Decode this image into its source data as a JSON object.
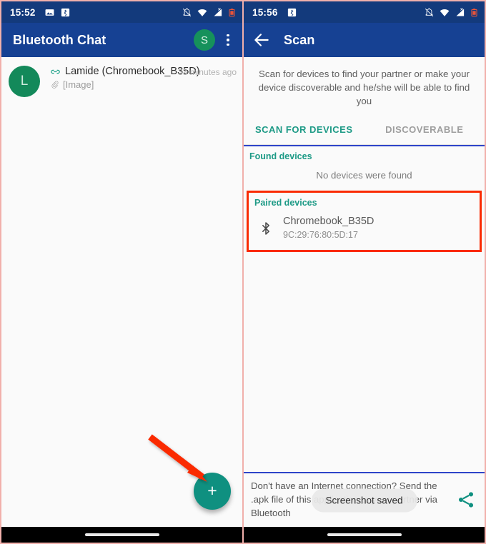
{
  "left_phone": {
    "status_bar": {
      "time": "15:52",
      "left_icons": [
        "image-icon",
        "bluetooth-box-icon"
      ],
      "right_icons": [
        "notifications-off-icon",
        "wifi-icon",
        "cellular-signal-icon",
        "battery-low-icon"
      ]
    },
    "app_bar": {
      "title": "Bluetooth Chat",
      "avatar_letter": "S",
      "overflow_menu": "overflow-menu-icon"
    },
    "chat_list": [
      {
        "avatar_letter": "L",
        "link_icon": "link-icon",
        "name": "Lamide (Chromebook_B35D)",
        "attachment_icon": "paperclip-icon",
        "snippet": "[Image]",
        "time": "33 minutes ago"
      }
    ],
    "fab": {
      "label": "+",
      "name": "new-chat-fab",
      "color": "#0f9080"
    },
    "annotation": {
      "type": "arrow",
      "color": "#fa2a00",
      "points_to": "new-chat-fab"
    }
  },
  "right_phone": {
    "status_bar": {
      "time": "15:56",
      "left_icons": [
        "bluetooth-box-icon"
      ],
      "right_icons": [
        "notifications-off-icon",
        "wifi-icon",
        "cellular-signal-icon",
        "battery-low-icon"
      ]
    },
    "app_bar": {
      "back_icon": "back-arrow-icon",
      "title": "Scan"
    },
    "description": "Scan for devices to find your partner or make your device discoverable and he/she will be able to find you",
    "tabs": [
      {
        "label": "SCAN FOR DEVICES",
        "active": true
      },
      {
        "label": "DISCOVERABLE",
        "active": false
      }
    ],
    "found_devices": {
      "header": "Found devices",
      "empty_text": "No devices were found",
      "items": []
    },
    "paired_devices": {
      "header": "Paired devices",
      "highlighted": true,
      "highlight_color": "#fa2a00",
      "items": [
        {
          "icon": "bluetooth-icon",
          "name": "Chromebook_B35D",
          "mac": "9C:29:76:80:5D:17"
        }
      ]
    },
    "footer": {
      "text": "Don't have an Internet connection? Send the .apk file of this application to your partner via Bluetooth",
      "share_icon": "share-icon"
    },
    "toast": {
      "message": "Screenshot saved"
    }
  },
  "theme": {
    "status_bar_bg": "#133a7c",
    "app_bar_bg": "#164193",
    "accent_teal": "#1d9a86",
    "accent_green": "#13895a",
    "divider_blue": "#2d44c9",
    "highlight_red": "#fa2a00",
    "panel_border": "#f1b0ab"
  }
}
